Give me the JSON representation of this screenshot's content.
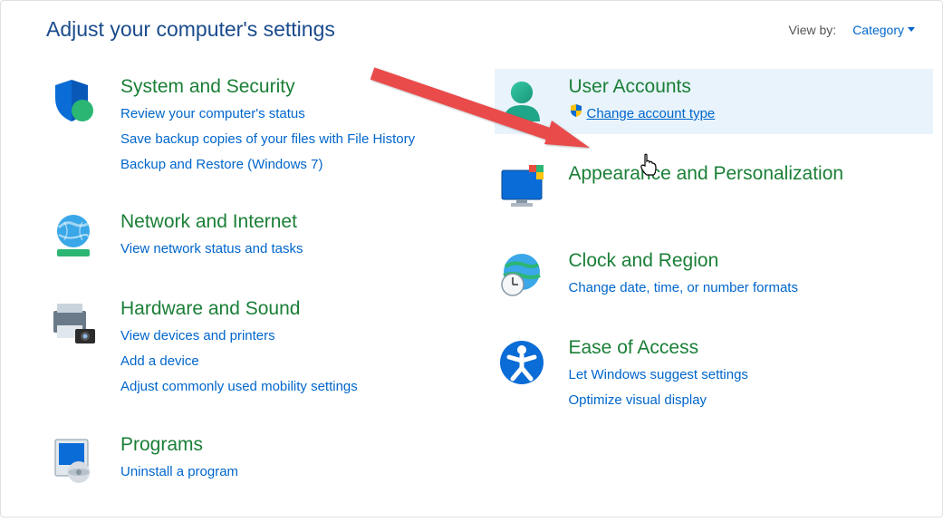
{
  "header": {
    "title": "Adjust your computer's settings",
    "view_by_label": "View by:",
    "view_by_value": "Category"
  },
  "left": [
    {
      "title": "System and Security",
      "links": [
        "Review your computer's status",
        "Save backup copies of your files with File History",
        "Backup and Restore (Windows 7)"
      ]
    },
    {
      "title": "Network and Internet",
      "links": [
        "View network status and tasks"
      ]
    },
    {
      "title": "Hardware and Sound",
      "links": [
        "View devices and printers",
        "Add a device",
        "Adjust commonly used mobility settings"
      ]
    },
    {
      "title": "Programs",
      "links": [
        "Uninstall a program"
      ]
    }
  ],
  "right": [
    {
      "title": "User Accounts",
      "links": [
        "Change account type"
      ],
      "hovered": true,
      "active_link": 0,
      "shield": true
    },
    {
      "title": "Appearance and Personalization",
      "links": []
    },
    {
      "title": "Clock and Region",
      "links": [
        "Change date, time, or number formats"
      ]
    },
    {
      "title": "Ease of Access",
      "links": [
        "Let Windows suggest settings",
        "Optimize visual display"
      ]
    }
  ]
}
